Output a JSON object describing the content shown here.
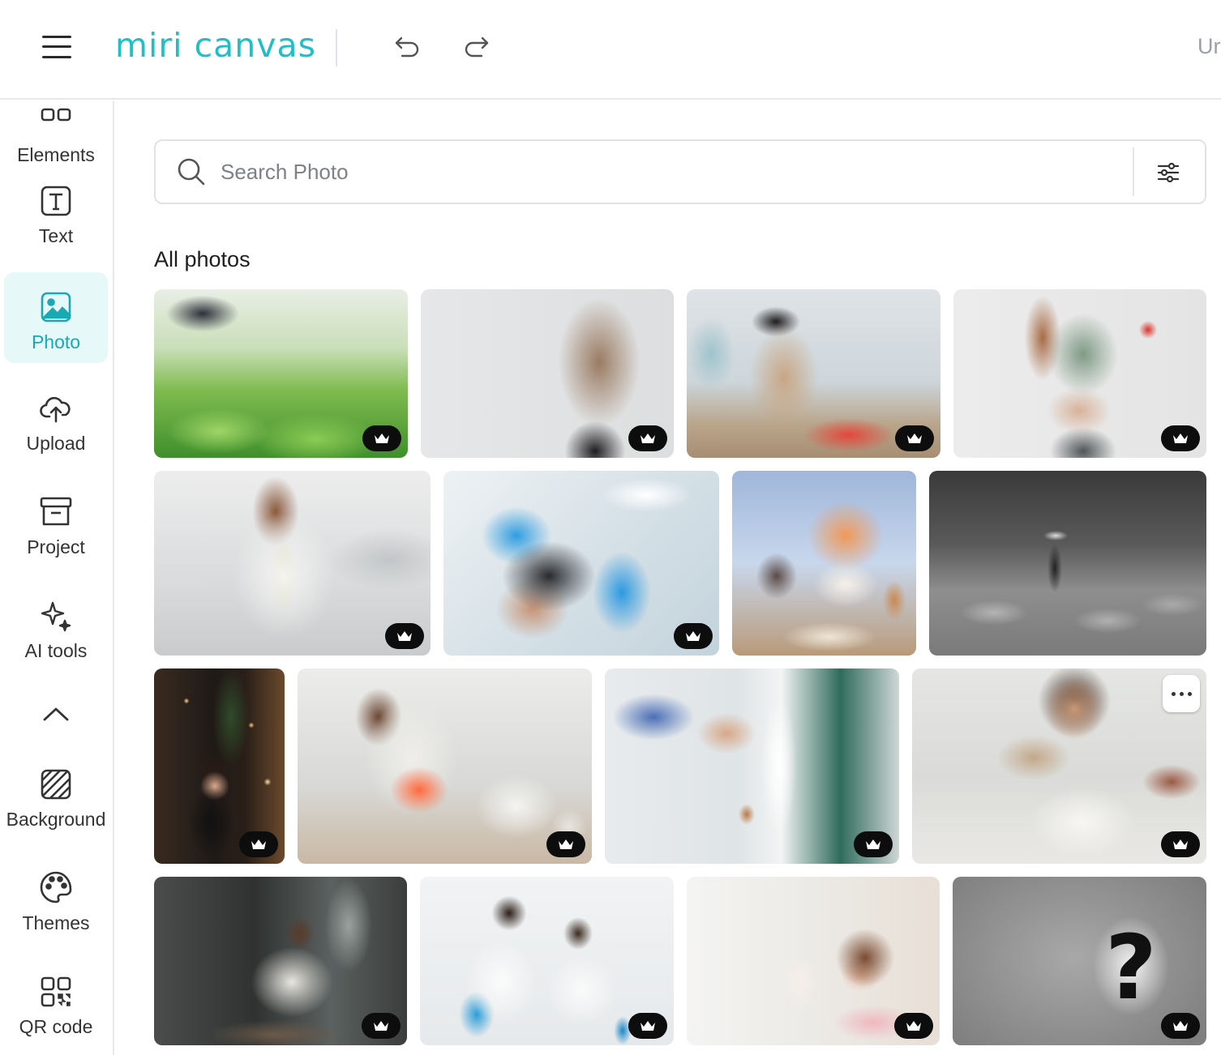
{
  "header": {
    "logo": "miri canvas",
    "right_text": "Ur"
  },
  "sidebar": {
    "items": [
      {
        "label": "Elements",
        "icon": "elements-icon"
      },
      {
        "label": "Text",
        "icon": "text-icon"
      },
      {
        "label": "Photo",
        "icon": "photo-icon",
        "active": true
      },
      {
        "label": "Upload",
        "icon": "upload-cloud-icon"
      },
      {
        "label": "Project",
        "icon": "archive-box-icon"
      },
      {
        "label": "AI tools",
        "icon": "sparkle-icon"
      },
      {
        "label": "",
        "icon": "chevron-up-icon"
      },
      {
        "label": "Background",
        "icon": "background-pattern-icon"
      },
      {
        "label": "Themes",
        "icon": "palette-icon"
      },
      {
        "label": "QR code",
        "icon": "qr-code-icon"
      }
    ]
  },
  "search": {
    "placeholder": "Search Photo",
    "value": ""
  },
  "section": {
    "title": "All photos"
  },
  "colors": {
    "accent": "#1fbfc9",
    "active_bg": "#e7f8f9",
    "premium_badge": "#0d0d0d"
  },
  "photos": [
    {
      "id": "farmer-lettuce",
      "premium": true
    },
    {
      "id": "woman-stomach-ache",
      "premium": true
    },
    {
      "id": "girl-playing-toys",
      "premium": true
    },
    {
      "id": "woman-measuring-waist-apple",
      "premium": true
    },
    {
      "id": "woman-back-pain-sofa",
      "premium": true
    },
    {
      "id": "scalp-injection",
      "premium": true
    },
    {
      "id": "cartoon-cats-reading",
      "premium": false
    },
    {
      "id": "farmer-field-bw",
      "premium": false
    },
    {
      "id": "woman-christmas-window",
      "premium": true
    },
    {
      "id": "woman-abdominal-pain-calendar",
      "premium": true
    },
    {
      "id": "hand-key-door",
      "premium": true
    },
    {
      "id": "woman-help-sign",
      "premium": true,
      "hovered": true
    },
    {
      "id": "woman-sitting-floor-sad",
      "premium": true
    },
    {
      "id": "kids-science-lab",
      "premium": true
    },
    {
      "id": "girl-mirror",
      "premium": true
    },
    {
      "id": "question-mark-cards",
      "premium": true
    }
  ]
}
